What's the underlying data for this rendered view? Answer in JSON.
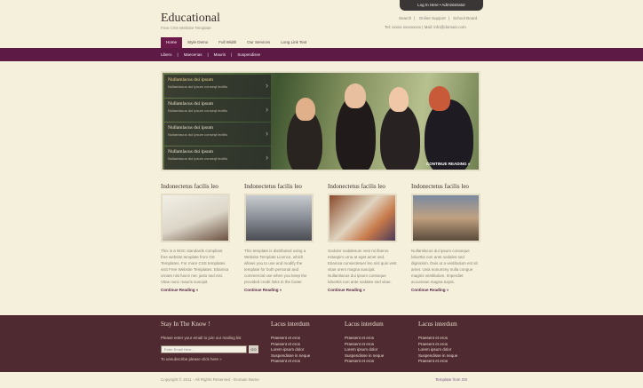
{
  "header": {
    "title": "Educational",
    "tagline": "Free CSS Website Template",
    "login": "Log In Here • Administrator",
    "links": [
      "Search",
      "Online Support",
      "School Board"
    ],
    "contact": "Tel: xxxxx xxxxxxxxx | Mail: info@domain.com"
  },
  "nav": {
    "items": [
      "Home",
      "Style Demo",
      "Full Width",
      "Our Services",
      "Long Link Text"
    ],
    "active": "Home"
  },
  "subnav": {
    "items": [
      "Libero",
      "Maecenas",
      "Mauris",
      "Suspendisse"
    ]
  },
  "hero": {
    "slides": [
      {
        "title": "Nullamlacus dui ipsum",
        "sub": "Nullamlacus dui ipsum conseqt lectilis"
      },
      {
        "title": "Nullamlacus dui ipsum",
        "sub": "Nullamlacus dui ipsum conseqt lectilis"
      },
      {
        "title": "Nullamlacus dui ipsum",
        "sub": "Nullamlacus dui ipsum conseqt lectilis"
      },
      {
        "title": "Nullamlacus dui ipsum",
        "sub": "Nullamlacus dui ipsum conseqt lectilis"
      }
    ],
    "continue": "CONTINUE READING »"
  },
  "columns": [
    {
      "title": "Indonectetus facilis leo",
      "text": "This is a W3C standards compliant free website template from OS Templates. For more CSS templates visit Free Website Templates. Etiamsa ornare nisi fusce nec justo sed nisi. Vitae nunc mauris suscipit.",
      "more": "Continue Reading »"
    },
    {
      "title": "Indonectetus facilis leo",
      "text": "This template is distributed using a Website Template Licence, which allows you to use and modify the template for both personal and commercial use when you keep the provided credit links in the footer.",
      "more": "Continue Reading »"
    },
    {
      "title": "Indonectetus facilis leo",
      "text": "Sodolor sodalesum vest mi liberos estaspim urna at eget amet sed. Etiamsa consectetuer leo nisl quis vest vitae orem magna suscipit. Nullamlacus dui ipsum conseque loborttis non ante sodales sed vitae.",
      "more": "Continue Reading »"
    },
    {
      "title": "Indonectetus facilis leo",
      "text": "Nullamlacus dui ipsum conseque loborttis non ante sodales sed dignissim. Duis ut a vestibulum est sit amet. Uvia nonummy nulla congue magnis vestibulum. Imperdiet accumsan magna turpis.",
      "more": "Continue Reading »"
    }
  ],
  "footer": {
    "stay_title": "Stay In The Know !",
    "stay_text": "Please enter your email to join our mailing list",
    "email_placeholder": "Enter Email Here...",
    "go": "GO",
    "unsubscribe": "To unsubscribe please click here »",
    "lists": [
      {
        "title": "Lacus interdum",
        "items": [
          "Praesent et eros",
          "Praesent et eros",
          "Lorem ipsum dolor",
          "Suspendisse in neque",
          "Praesent et eros"
        ]
      },
      {
        "title": "Lacus interdum",
        "items": [
          "Praesent et eros",
          "Praesent et eros",
          "Lorem ipsum dolor",
          "Suspendisse in neque",
          "Praesent et eros"
        ]
      },
      {
        "title": "Lacus interdum",
        "items": [
          "Praesent et eros",
          "Praesent et eros",
          "Lorem ipsum dolor",
          "Suspendisse in neque",
          "Praesent et eros"
        ]
      }
    ]
  },
  "bottom": {
    "copyright": "Copyright © 2011 - All Rights Reserved - Domain Name",
    "credit": "Template from OS"
  }
}
